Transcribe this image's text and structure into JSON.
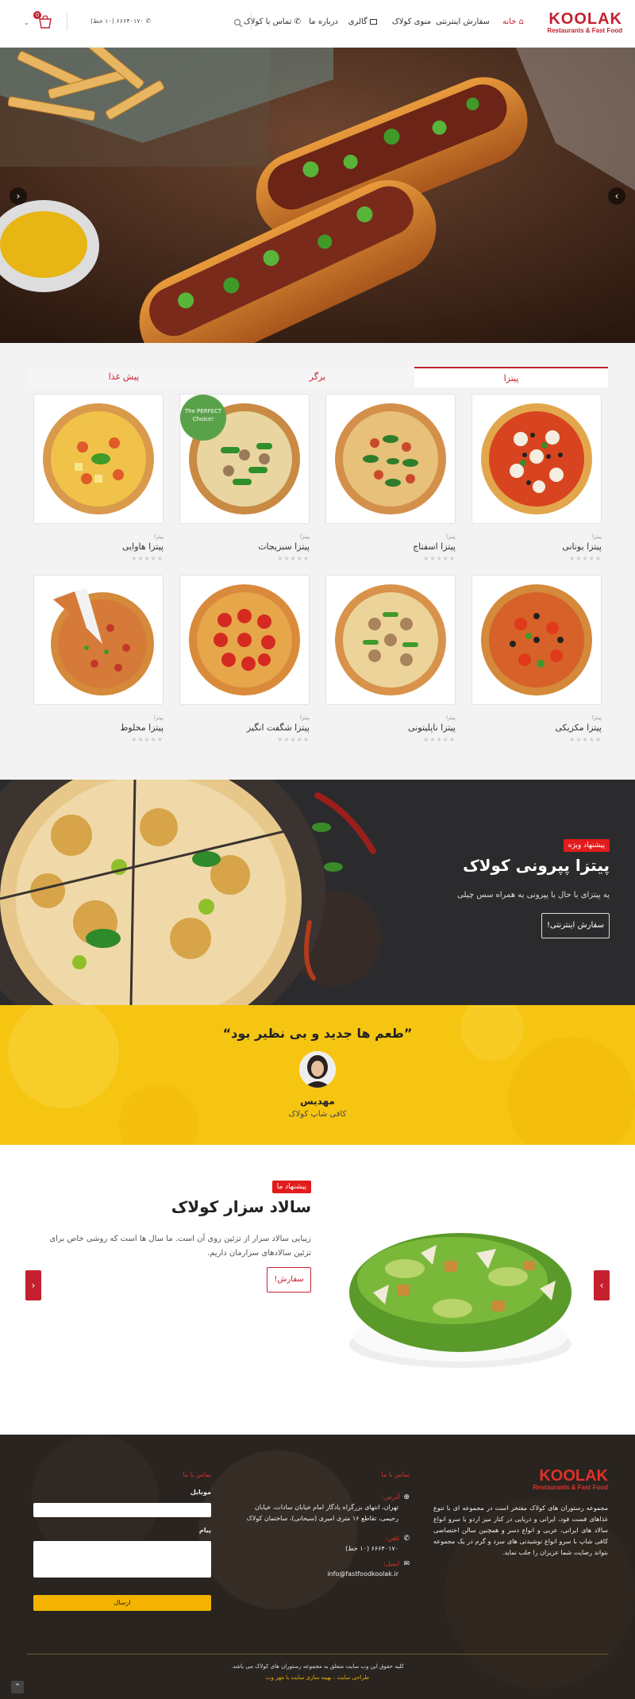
{
  "header": {
    "logo_main": "KOOLAK",
    "logo_sub": "Restaurants & Fast Food",
    "nav": {
      "home": "خانه",
      "online_order": "سفارش اینترنتی",
      "menu": "منوی کولاک",
      "gallery": "گالری",
      "about": "درباره ما",
      "contact": "تماس با کولاک"
    },
    "phone": "۶۶۶۴۰۱۷۰ (۱۰ خط)",
    "cart_count": "0"
  },
  "tabs": {
    "pizza": "پیتزا",
    "burger": "برگر",
    "appetizer": "پیش غذا"
  },
  "products": {
    "row1": [
      {
        "cat": "پیتزا",
        "name": "پیتزا یونانی",
        "stars": "★★★★★"
      },
      {
        "cat": "پیتزا",
        "name": "پیتزا اسفناج",
        "stars": "★★★★★"
      },
      {
        "cat": "پیتزا",
        "name": "پیتزا سبزیجات",
        "stars": "★★★★★"
      },
      {
        "cat": "پیتزا",
        "name": "پیتزا هاوایی",
        "stars": "★★★★★"
      }
    ],
    "row2": [
      {
        "cat": "پیتزا",
        "name": "پیتزا مکزیکی",
        "stars": "★★★★★"
      },
      {
        "cat": "پیتزا",
        "name": "پیتزا ناپلیتونی",
        "stars": "★★★★★"
      },
      {
        "cat": "پیتزا",
        "name": "پیتزا شگفت انگیز",
        "stars": "★★★★★"
      },
      {
        "cat": "پیتزا",
        "name": "پیتزا مخلوط",
        "stars": "★★★★★"
      }
    ],
    "perfect_choice": "The PERFECT Choice!"
  },
  "special": {
    "badge": "پیشنهاد ویژه",
    "title": "پیتزا پپرونی کولاک",
    "desc": "یه پیتزای با حال با پپرونی به همراه سس چیلی",
    "button": "سفارش اینترنتی!"
  },
  "testimonial": {
    "quote": "”طعم ها جدید و بی نظیر بود“",
    "name": "مهدیس",
    "role": "کافی شاپ کولاک"
  },
  "salad": {
    "badge": "پیشنهاد ما",
    "title": "سالاد سزار کولاک",
    "desc": "زیبایی سالاد سزار از تزئین روی آن است. ما سال ها است که روشی خاص برای تزئین سالادهای سزارمان داریم.",
    "button": "سفارش!"
  },
  "footer": {
    "logo_main": "KOOLAK",
    "logo_sub": "Restaurants & Fast Food",
    "about": "مجموعه رستوران های کولاک مفتخر است در مجموعه ای با تنوع غذاهای فست فود، ایرانی و دریایی در کنار میز اردو با سرو انواع سالاد های ایرانی، عربی و انواع دسر و همچنین سالن اختصاصی کافی شاپ با سرو انواع نوشیدنی های سرد و گرم در یک مجموعه بتواند رضایت شما عزیزان را جلب نماید.",
    "contact_title": "تماس با ما",
    "address_label": "آدرس:",
    "address": "تهران، انتهای بزرگراه یادگار امام خیابان سادات، خیابان رحیمی، تقاطع ۱۶ متری امیری (سیحانی)، ساختمان کولاک",
    "phone_label": "تلفن:",
    "phone": "۶۶۶۴۰۱۷۰ (۱۰ خط)",
    "email_label": "ایمیل:",
    "email": "info@fastfoodkoolak.ir",
    "form_title": "تماس با ما",
    "mobile_label": "موبایل",
    "message_label": "پیام",
    "send": "ارسال",
    "copyright": "کلیه حقوق این وب سایت متعلق به مجموعه رستوران های کولاک می باشد.",
    "credit": "طراحی سایت ، بهینه سازی سایت با مهر وب"
  }
}
